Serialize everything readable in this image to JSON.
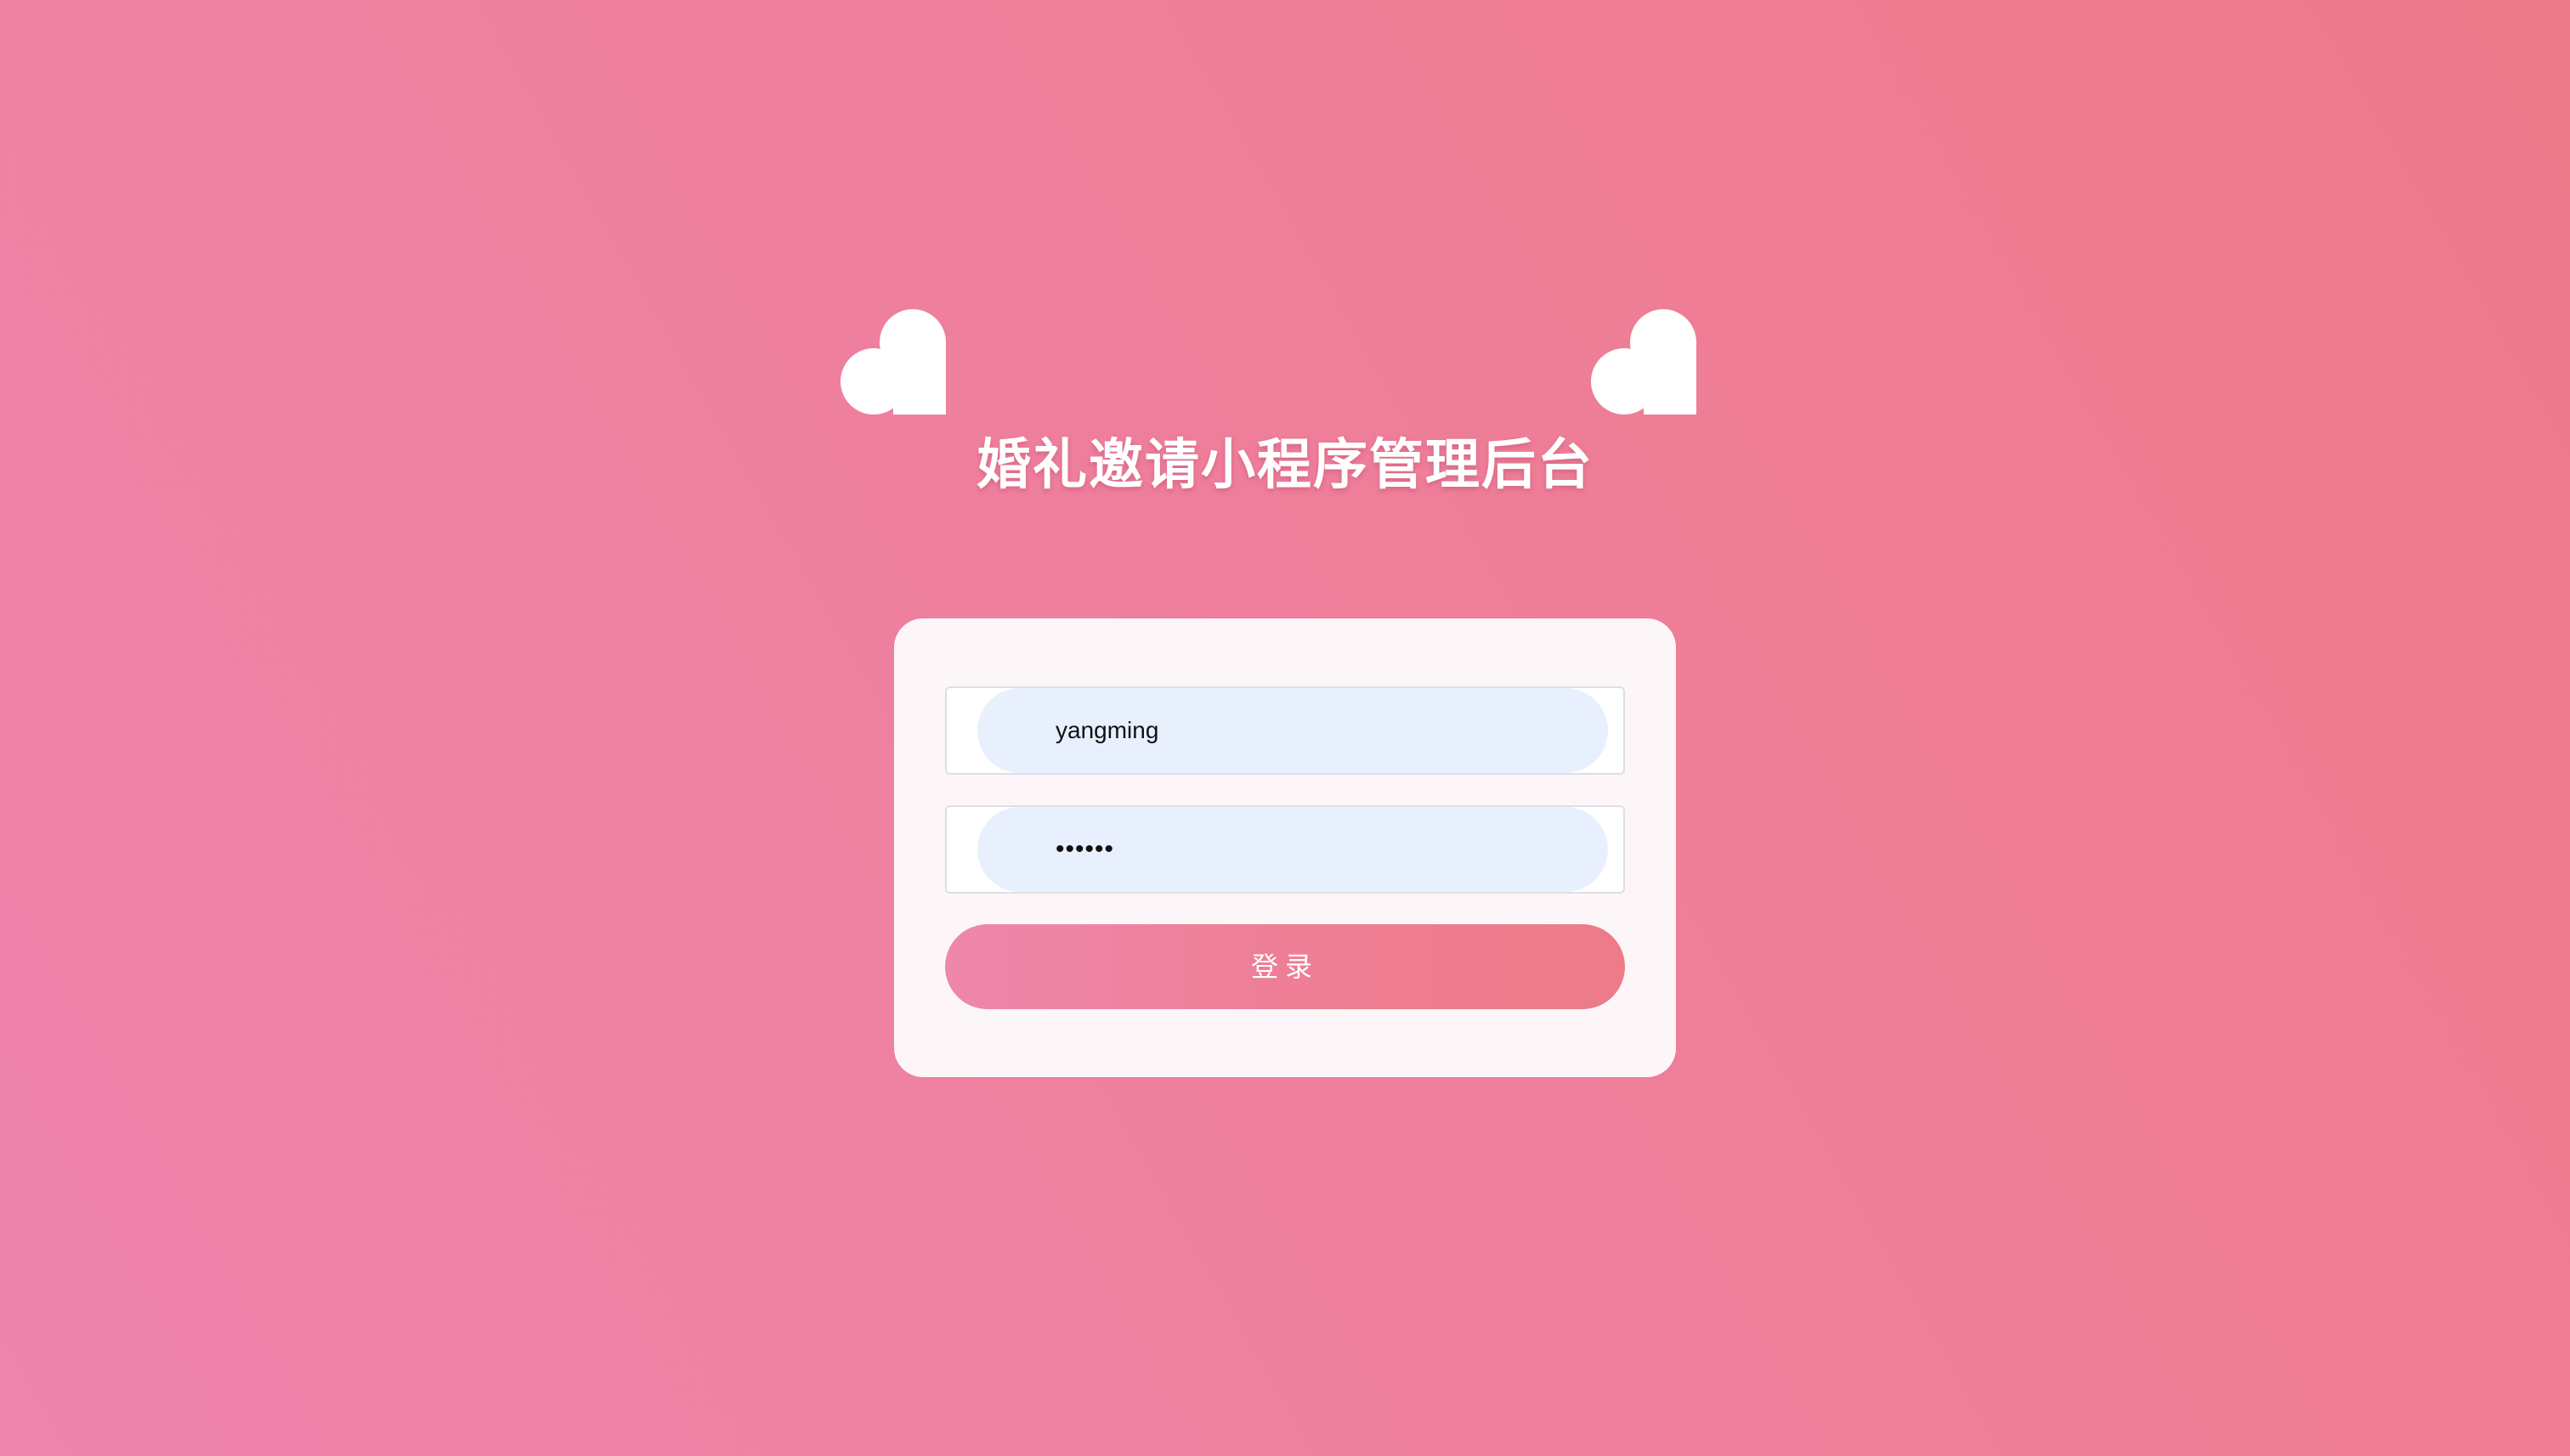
{
  "page": {
    "title": "婚礼邀请小程序管理后台"
  },
  "login_form": {
    "username_value": "yangming",
    "password_value": "••••••",
    "submit_label": "登录"
  },
  "theme": {
    "background_start": "#ef84ac",
    "background_end": "#ed7a8a",
    "card_background": "#fdf6f8",
    "input_fill": "#e8f0fe",
    "heart_color": "#ffffff"
  },
  "icons": {
    "left_decoration": "heart-icon",
    "right_decoration": "heart-icon"
  }
}
